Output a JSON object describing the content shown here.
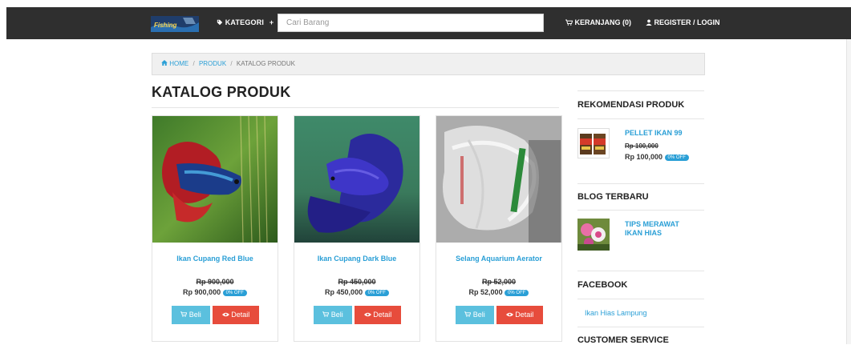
{
  "header": {
    "logo_text": "Fishing",
    "kategori_label": "KATEGORI",
    "kategori_plus": "+",
    "search_placeholder": "Cari Barang",
    "cart_label": "KERANJANG (0)",
    "login_label": "REGISTER / LOGIN",
    "bg_color": "#2f2f2f"
  },
  "breadcrumb": {
    "home": "HOME",
    "produk": "PRODUK",
    "current": "KATALOG PRODUK",
    "separator": "/"
  },
  "page": {
    "title": "KATALOG PRODUK"
  },
  "products": [
    {
      "name": "Ikan Cupang Red Blue",
      "old_price": "Rp 900,000",
      "new_price": "Rp 900,000",
      "badge": "0% OFF",
      "buy_label": "Beli",
      "detail_label": "Detail"
    },
    {
      "name": "Ikan Cupang Dark Blue",
      "old_price": "Rp 450,000",
      "new_price": "Rp 450,000",
      "badge": "0% OFF",
      "buy_label": "Beli",
      "detail_label": "Detail"
    },
    {
      "name": "Selang Aquarium Aerator",
      "old_price": "Rp 52,000",
      "new_price": "Rp 52,000",
      "badge": "0% OFF",
      "buy_label": "Beli",
      "detail_label": "Detail"
    }
  ],
  "sidebar": {
    "rekomendasi_title": "REKOMENDASI PRODUK",
    "rekomendasi": {
      "name": "PELLET IKAN 99",
      "old_price": "Rp 100,000",
      "new_price": "Rp 100,000",
      "badge": "0% OFF"
    },
    "blog_title": "BLOG TERBARU",
    "blog": {
      "title": "TIPS MERAWAT IKAN HIAS"
    },
    "facebook_title": "FACEBOOK",
    "facebook_link": "Ikan Hias Lampung",
    "customer_title": "CUSTOMER SERVICE"
  },
  "colors": {
    "link": "#2a9fd6",
    "beli": "#5bc0de",
    "detail": "#e74c3c"
  }
}
